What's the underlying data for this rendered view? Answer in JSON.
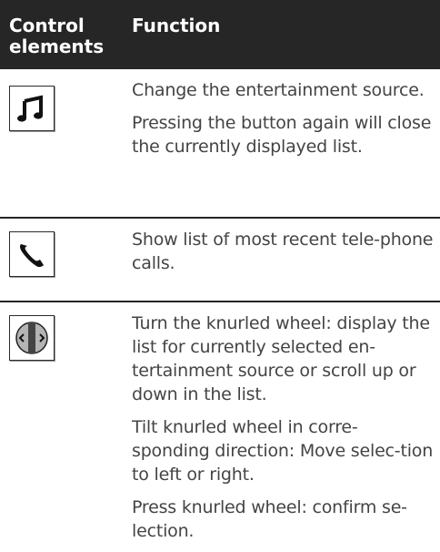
{
  "header": {
    "col_controls": "Control\nelements",
    "col_function": "Function"
  },
  "rows": [
    {
      "icon": "music-note-icon",
      "paragraphs": [
        "Change the entertainment source.",
        "Pressing the button again will close the currently displayed list."
      ]
    },
    {
      "icon": "telephone-handset-icon",
      "paragraphs": [
        "Show list of most recent tele-phone calls."
      ]
    },
    {
      "icon": "knurled-wheel-icon",
      "paragraphs": [
        "Turn the knurled wheel: display the list for currently selected en-tertainment source or scroll up or down in the list.",
        "Tilt knurled wheel in corre-sponding direction: Move selec-tion to left or right.",
        "Press knurled wheel: confirm se-lection."
      ]
    }
  ]
}
